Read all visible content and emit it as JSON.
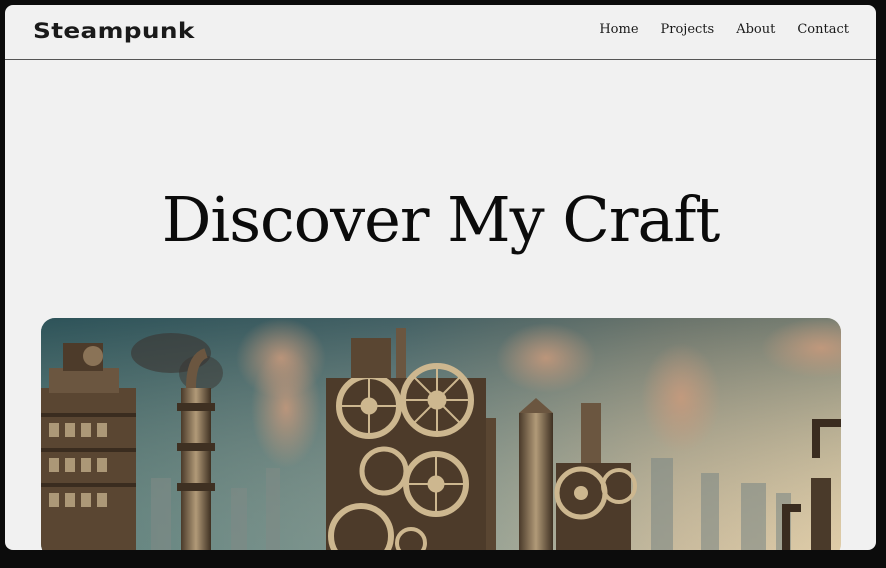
{
  "nav": {
    "brand": "Steampunk",
    "links": [
      "Home",
      "Projects",
      "About",
      "Contact"
    ]
  },
  "hero": {
    "title": "Discover My Craft"
  },
  "colors": {
    "page_bg": "#f1f1f1",
    "text": "#0b0b0b",
    "frame": "#0c0c0c"
  }
}
